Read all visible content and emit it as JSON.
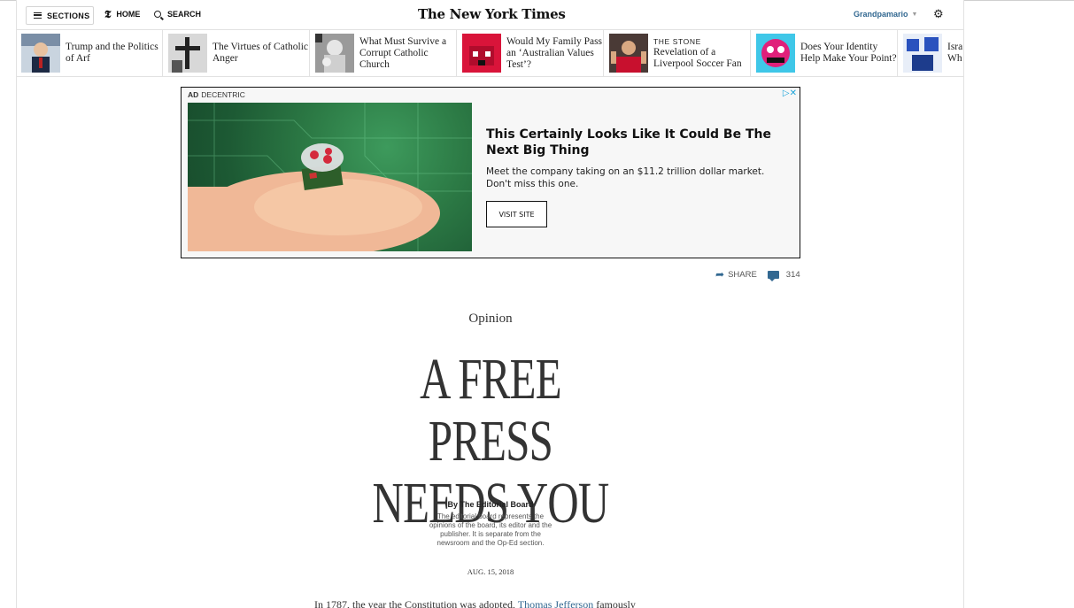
{
  "masthead": {
    "sections_label": "SECTIONS",
    "home_label": "HOME",
    "search_label": "SEARCH",
    "logo_text": "The New York Times",
    "username": "Grandpamario"
  },
  "ribbon": {
    "items": [
      {
        "title": "Trump and the Politics of Arf"
      },
      {
        "title": "The Virtues of Catholic Anger"
      },
      {
        "title": "What Must Survive a Corrupt Catholic Church"
      },
      {
        "title": "Would My Family Pass an ‘Australian Values Test’?"
      },
      {
        "kicker": "THE STONE",
        "title": "Revelation of a Liverpool Soccer Fan"
      },
      {
        "title": "Does Your Identity Help Make Your Point?"
      },
      {
        "title": "Isra Wh"
      }
    ]
  },
  "ad": {
    "label_bold": "AD",
    "label": "DECENTRIC",
    "headline": "This Certainly Looks Like It Could Be The Next Big Thing",
    "body": "Meet the company taking on an $11.2 trillion dollar market. Don't miss this one.",
    "cta": "VISIT SITE"
  },
  "share": {
    "label": "SHARE",
    "comment_count": "314"
  },
  "article": {
    "section": "Opinion",
    "headline_line1": "A FREE PRESS",
    "headline_line2": "NEEDS YOU",
    "byline": "By The Editorial Board",
    "bio": "The editorial board represents the opinions of the board, its editor and the publisher. It is separate from the newsroom and the Op-Ed section.",
    "date": "AUG. 15, 2018",
    "body_start": "In 1787, the year the Constitution was adopted,",
    "body_link": "Thomas Jefferson",
    "body_end": "famously"
  },
  "colors": {
    "link": "#326891",
    "ad_green": "#2c7a45"
  }
}
